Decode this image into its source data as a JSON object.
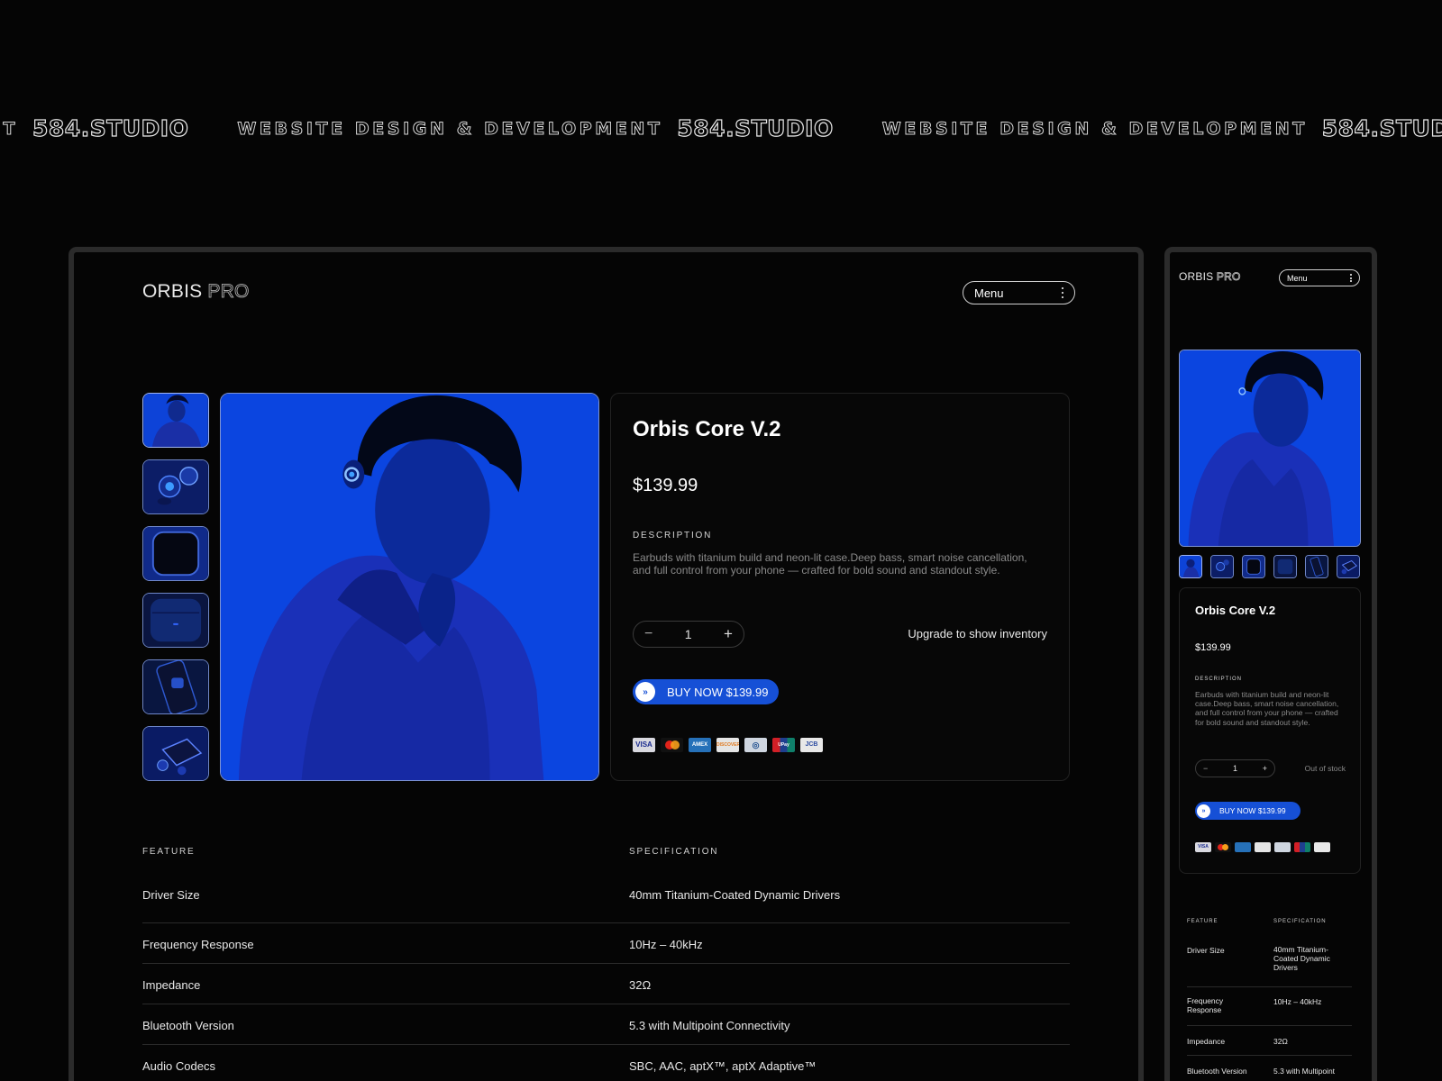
{
  "marquee": {
    "tagline": "WEBSITE DESIGN & DEVELOPMENT",
    "brand": "584.STUDIO"
  },
  "brand": {
    "name": "ORBIS",
    "suffix": "PRO"
  },
  "nav": {
    "menu_label": "Menu"
  },
  "product": {
    "title": "Orbis Core V.2",
    "price": "$139.99",
    "description_label": "DESCRIPTION",
    "description": "Earbuds with titanium build and neon-lit case.Deep bass, smart noise cancellation, and full control from your phone — crafted for bold sound and standout style.",
    "quantity": "1",
    "minus": "−",
    "plus": "+",
    "inventory_desktop": "Upgrade to show inventory",
    "inventory_mobile": "Out of stock",
    "buy_label": "BUY NOW $139.99"
  },
  "payments": [
    "VISA",
    "MC",
    "AMEX",
    "DISCOVER",
    "DINERS",
    "UnionPay",
    "JCB"
  ],
  "specs": {
    "feature_header": "FEATURE",
    "spec_header": "SPECIFICATION",
    "rows": [
      {
        "feature": "Driver Size",
        "spec": "40mm Titanium-Coated Dynamic Drivers"
      },
      {
        "feature": "Frequency Response",
        "spec": "10Hz – 40kHz"
      },
      {
        "feature": "Impedance",
        "spec": "32Ω"
      },
      {
        "feature": "Bluetooth Version",
        "spec": "5.3 with Multipoint Connectivity"
      },
      {
        "feature": "Audio Codecs",
        "spec": "SBC, AAC, aptX™, aptX Adaptive™"
      }
    ],
    "mobile_rows": [
      {
        "feature": "Driver Size",
        "spec": "40mm Titanium-Coated Dynamic Drivers"
      },
      {
        "feature": "Frequency Response",
        "spec": "10Hz – 40kHz"
      },
      {
        "feature": "Impedance",
        "spec": "32Ω"
      },
      {
        "feature": "Bluetooth Version",
        "spec": "5.3 with Multipoint"
      }
    ]
  },
  "colors": {
    "accent": "#1650d6",
    "background": "#050505",
    "frame": "#2b2b2b"
  }
}
